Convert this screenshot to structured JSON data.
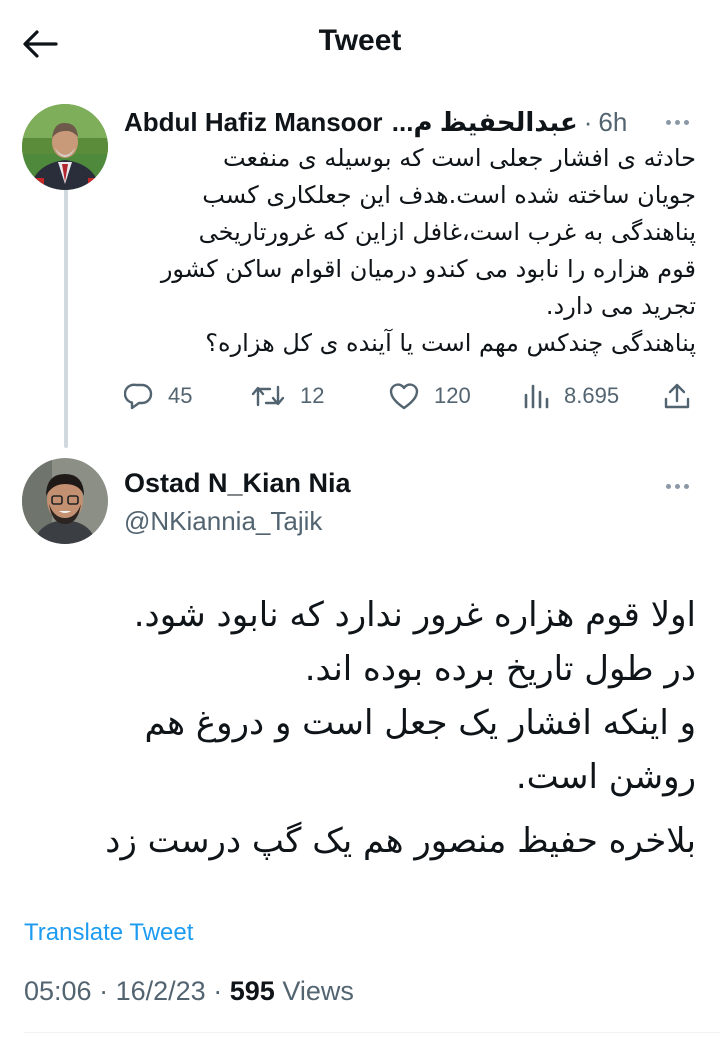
{
  "header": {
    "title": "Tweet",
    "back_icon": "arrow-left-icon"
  },
  "quoted_tweet": {
    "author_name": "Abdul Hafiz Mansoor",
    "author_name_rtl": "عبدالحفیظ م...",
    "separator": "·",
    "time": "6h",
    "body_lines": [
      "حادثه ی افشار جعلی است که بوسیله ی منفعت",
      "جویان ساخته شده است.هدف این جعلکاری کسب",
      "پناهندگی به غرب است،غافل ازاین که غرورتاریخی",
      "قوم هزاره را نابود می کندو درمیان اقوام ساکن کشور",
      "تجرید می دارد.",
      "پناهندگی چندکس مهم است یا آینده ی کل هزاره؟"
    ],
    "stats": {
      "replies": "45",
      "retweets": "12",
      "likes": "120",
      "views": "8.695"
    }
  },
  "tweet": {
    "author_name": "Ostad N_Kian Nia",
    "handle": "@NKiannia_Tajik",
    "body_lines": [
      "اولا قوم هزاره غرور ندارد که نابود شود.",
      "در طول تاریخ برده بوده اند.",
      "و اینکه افشار یک جعل است و دروغ هم",
      "روشن است."
    ],
    "body_last": "بلاخره حفیظ منصور هم یک گپ درست زد",
    "translate_label": "Translate Tweet",
    "time": "05:06",
    "date": "16/2/23",
    "separator": "·",
    "views_count": "595",
    "views_label": "Views"
  },
  "colors": {
    "accent": "#1d9bf0",
    "secondary_text": "#536471",
    "primary_text": "#0f1419",
    "thread_line": "#cfd9de"
  }
}
